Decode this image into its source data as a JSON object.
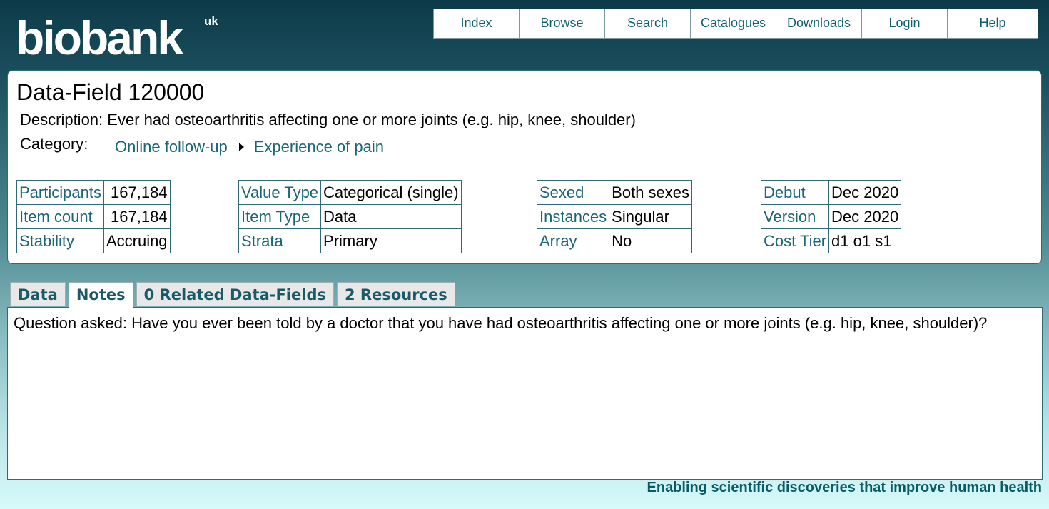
{
  "logo": {
    "text": "biobank",
    "sup": "uk"
  },
  "nav": [
    "Index",
    "Browse",
    "Search",
    "Catalogues",
    "Downloads",
    "Login",
    "Help"
  ],
  "field": {
    "title": "Data-Field 120000",
    "description_label": "Description:",
    "description": "Ever had osteoarthritis affecting one or more joints (e.g. hip, knee, shoulder)",
    "category_label": "Category:",
    "category_path": [
      "Online follow-up",
      "Experience of pain"
    ]
  },
  "tables": [
    [
      [
        "Participants",
        "167,184"
      ],
      [
        "Item count",
        "167,184"
      ],
      [
        "Stability",
        "Accruing"
      ]
    ],
    [
      [
        "Value Type",
        "Categorical (single)"
      ],
      [
        "Item Type",
        "Data"
      ],
      [
        "Strata",
        "Primary"
      ]
    ],
    [
      [
        "Sexed",
        "Both sexes"
      ],
      [
        "Instances",
        "Singular"
      ],
      [
        "Array",
        "No"
      ]
    ],
    [
      [
        "Debut",
        "Dec 2020"
      ],
      [
        "Version",
        "Dec 2020"
      ],
      [
        "Cost Tier",
        "d1 o1 s1"
      ]
    ]
  ],
  "tabs": [
    "Data",
    "Notes",
    "0 Related Data-Fields",
    "2 Resources"
  ],
  "active_tab": "Notes",
  "notes": "Question asked: Have you ever been told by a doctor that you have had osteoarthritis affecting one or more joints (e.g. hip, knee, shoulder)?",
  "footer": "Enabling scientific discoveries that improve human health"
}
